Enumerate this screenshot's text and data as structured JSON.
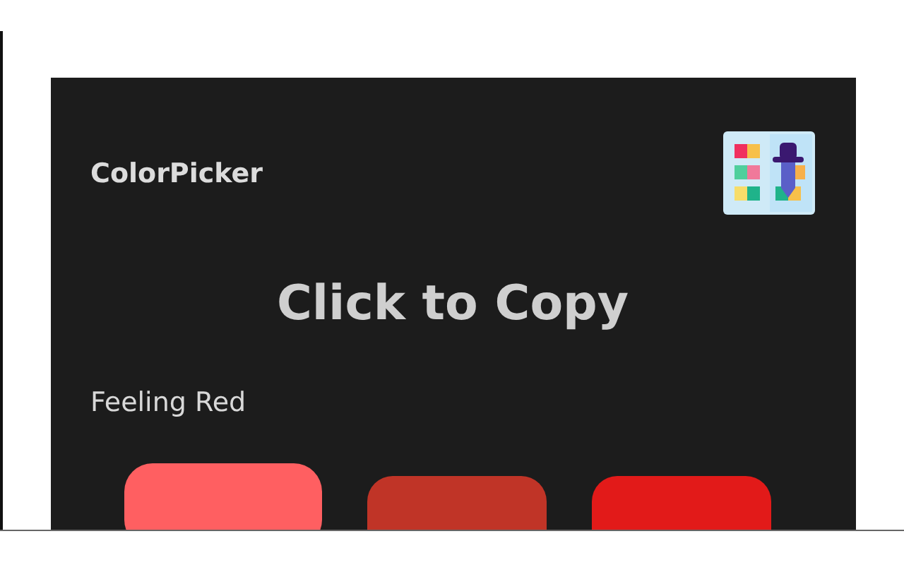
{
  "header": {
    "title": "ColorPicker"
  },
  "heading": "Click to Copy",
  "palette": {
    "name": "Feeling Red",
    "swatches": [
      {
        "color": "#ff5f61",
        "selected": true
      },
      {
        "color": "#c03427",
        "selected": false
      },
      {
        "color": "#e21a19",
        "selected": false
      }
    ]
  }
}
